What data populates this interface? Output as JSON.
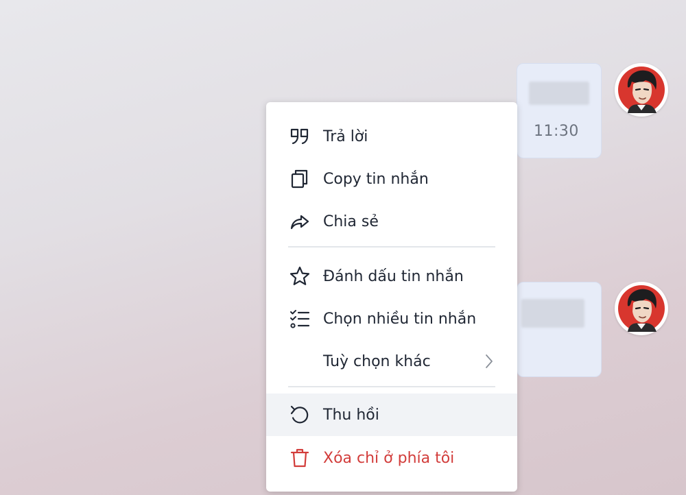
{
  "messages": [
    {
      "time": "11:30"
    },
    {
      "time": ""
    }
  ],
  "context_menu": {
    "items": [
      {
        "label": "Trả lời",
        "icon": "quote-icon"
      },
      {
        "label": "Copy tin nhắn",
        "icon": "copy-icon"
      },
      {
        "label": "Chia sẻ",
        "icon": "share-icon"
      },
      {
        "label": "Đánh dấu tin nhắn",
        "icon": "star-icon"
      },
      {
        "label": "Chọn nhiều tin nhắn",
        "icon": "checklist-icon"
      },
      {
        "label": "Tuỳ chọn khác",
        "icon": "chevron-right-icon"
      },
      {
        "label": "Thu hồi",
        "icon": "undo-icon"
      },
      {
        "label": "Xóa chỉ ở phía tôi",
        "icon": "trash-icon"
      }
    ]
  },
  "colors": {
    "danger": "#d23c3a",
    "bubble": "#e7ecf8",
    "avatar_bg": "#d8362e"
  }
}
